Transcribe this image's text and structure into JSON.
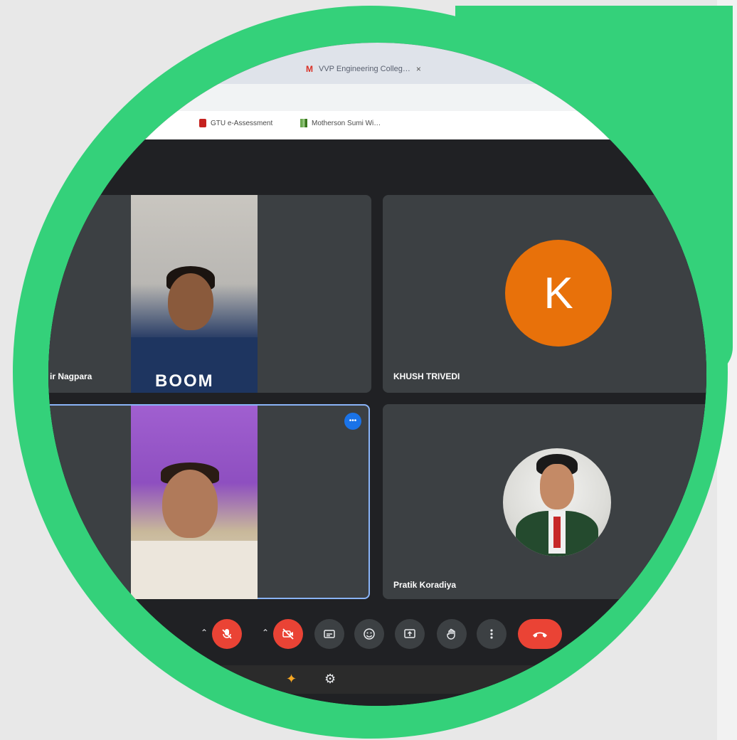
{
  "browser": {
    "tabs": [
      {
        "label": "",
        "close": "×"
      },
      {
        "label": "VVP Engineering Colleg…",
        "close": "×"
      }
    ],
    "bookmarks": [
      {
        "label": "GTU e-Assessment"
      },
      {
        "label": "Motherson Sumi Wi…"
      }
    ]
  },
  "meet": {
    "participants": [
      {
        "name": "ir Nagpara",
        "shirt_text": "BOOM"
      },
      {
        "name": "KHUSH TRIVEDI",
        "initial": "K",
        "avatar_color": "#e8710a"
      },
      {
        "name": "",
        "more": "•••"
      },
      {
        "name": "Pratik Koradiya"
      }
    ],
    "controls": {
      "mic": "mic-off-icon",
      "camera": "camera-off-icon",
      "captions": "captions-icon",
      "emoji": "emoji-icon",
      "present": "present-icon",
      "raise_hand": "raise-hand-icon",
      "more": "more-vert-icon",
      "end_call": "call-end-icon"
    }
  },
  "colors": {
    "frame": "#34d17a",
    "meet_bg": "#202124",
    "tile_bg": "#3c4043",
    "danger": "#ea4335",
    "accent": "#1a73e8"
  }
}
